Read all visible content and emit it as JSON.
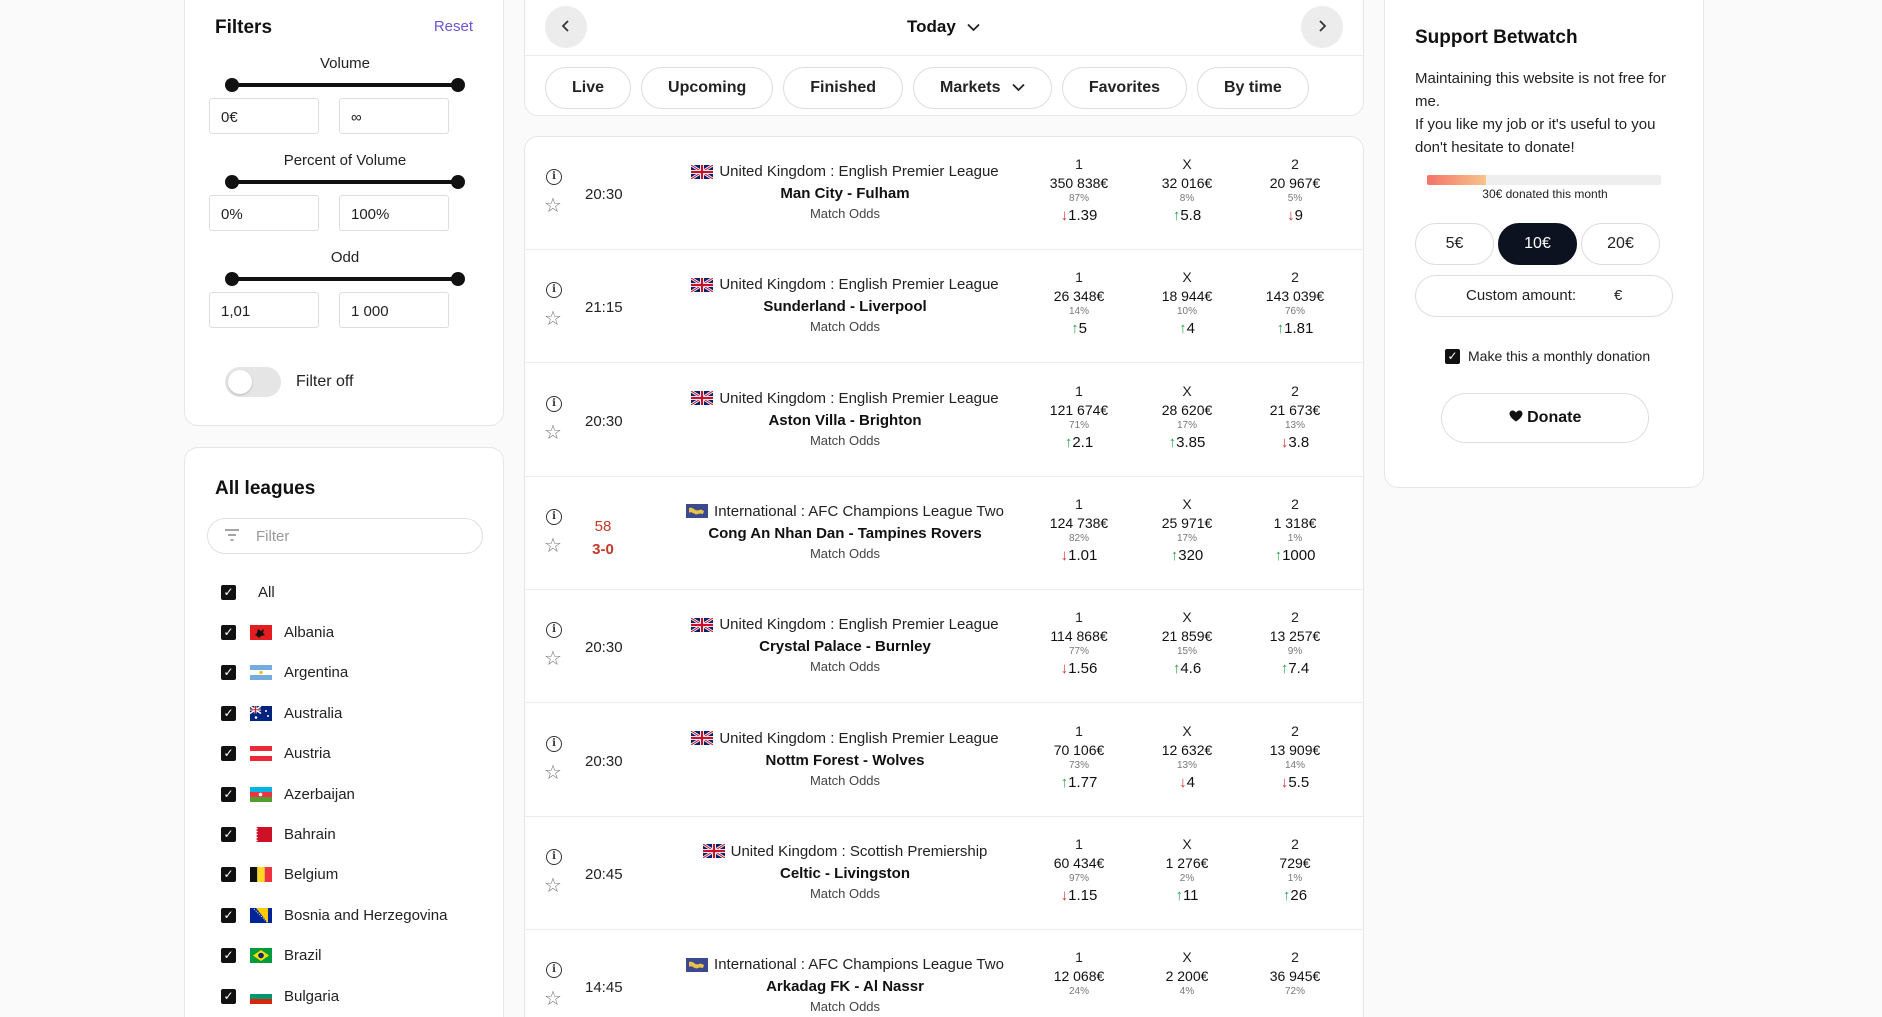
{
  "filters": {
    "title": "Filters",
    "reset": "Reset",
    "volume": {
      "label": "Volume",
      "min": "0€",
      "max": "∞"
    },
    "percent": {
      "label": "Percent of Volume",
      "min": "0%",
      "max": "100%"
    },
    "odd": {
      "label": "Odd",
      "min": "1,01",
      "max": "1 000"
    },
    "toggle_label": "Filter off"
  },
  "leagues": {
    "title": "All leagues",
    "search_placeholder": "Filter",
    "items": [
      {
        "label": "All",
        "checked": true
      },
      {
        "label": "Albania",
        "checked": true
      },
      {
        "label": "Argentina",
        "checked": true
      },
      {
        "label": "Australia",
        "checked": true
      },
      {
        "label": "Austria",
        "checked": true
      },
      {
        "label": "Azerbaijan",
        "checked": true
      },
      {
        "label": "Bahrain",
        "checked": true
      },
      {
        "label": "Belgium",
        "checked": true
      },
      {
        "label": "Bosnia and Herzegovina",
        "checked": true
      },
      {
        "label": "Brazil",
        "checked": true
      },
      {
        "label": "Bulgaria",
        "checked": true
      }
    ]
  },
  "header": {
    "date": "Today",
    "tabs": [
      "Live",
      "Upcoming",
      "Finished",
      "Markets",
      "Favorites",
      "By time"
    ]
  },
  "matches": [
    {
      "time": "20:30",
      "flag": "uk",
      "league": "United Kingdom : English Premier League",
      "teams": "Man City - Fulham",
      "market": "Match Odds",
      "odds": [
        {
          "k": "1",
          "v": "350 838€",
          "p": "87%",
          "dir": "down",
          "o": "1.39"
        },
        {
          "k": "X",
          "v": "32 016€",
          "p": "8%",
          "dir": "up",
          "o": "5.8"
        },
        {
          "k": "2",
          "v": "20 967€",
          "p": "5%",
          "dir": "down",
          "o": "9"
        }
      ]
    },
    {
      "time": "21:15",
      "flag": "uk",
      "league": "United Kingdom : English Premier League",
      "teams": "Sunderland - Liverpool",
      "market": "Match Odds",
      "odds": [
        {
          "k": "1",
          "v": "26 348€",
          "p": "14%",
          "dir": "up",
          "o": "5"
        },
        {
          "k": "X",
          "v": "18 944€",
          "p": "10%",
          "dir": "up",
          "o": "4"
        },
        {
          "k": "2",
          "v": "143 039€",
          "p": "76%",
          "dir": "up",
          "o": "1.81"
        }
      ]
    },
    {
      "time": "20:30",
      "flag": "uk",
      "league": "United Kingdom : English Premier League",
      "teams": "Aston Villa - Brighton",
      "market": "Match Odds",
      "odds": [
        {
          "k": "1",
          "v": "121 674€",
          "p": "71%",
          "dir": "up",
          "o": "2.1"
        },
        {
          "k": "X",
          "v": "28 620€",
          "p": "17%",
          "dir": "up",
          "o": "3.85"
        },
        {
          "k": "2",
          "v": "21 673€",
          "p": "13%",
          "dir": "down",
          "o": "3.8"
        }
      ]
    },
    {
      "time": "58",
      "score": "3-0",
      "live": true,
      "flag": "intl",
      "league": "International : AFC Champions League Two",
      "teams": "Cong An Nhan Dan - Tampines Rovers",
      "market": "Match Odds",
      "odds": [
        {
          "k": "1",
          "v": "124 738€",
          "p": "82%",
          "dir": "down",
          "o": "1.01"
        },
        {
          "k": "X",
          "v": "25 971€",
          "p": "17%",
          "dir": "up",
          "o": "320"
        },
        {
          "k": "2",
          "v": "1 318€",
          "p": "1%",
          "dir": "up",
          "o": "1000"
        }
      ]
    },
    {
      "time": "20:30",
      "flag": "uk",
      "league": "United Kingdom : English Premier League",
      "teams": "Crystal Palace - Burnley",
      "market": "Match Odds",
      "odds": [
        {
          "k": "1",
          "v": "114 868€",
          "p": "77%",
          "dir": "down",
          "o": "1.56"
        },
        {
          "k": "X",
          "v": "21 859€",
          "p": "15%",
          "dir": "up",
          "o": "4.6"
        },
        {
          "k": "2",
          "v": "13 257€",
          "p": "9%",
          "dir": "up",
          "o": "7.4"
        }
      ]
    },
    {
      "time": "20:30",
      "flag": "uk",
      "league": "United Kingdom : English Premier League",
      "teams": "Nottm Forest - Wolves",
      "market": "Match Odds",
      "odds": [
        {
          "k": "1",
          "v": "70 106€",
          "p": "73%",
          "dir": "up",
          "o": "1.77"
        },
        {
          "k": "X",
          "v": "12 632€",
          "p": "13%",
          "dir": "down",
          "o": "4"
        },
        {
          "k": "2",
          "v": "13 909€",
          "p": "14%",
          "dir": "down",
          "o": "5.5"
        }
      ]
    },
    {
      "time": "20:45",
      "flag": "uk",
      "league": "United Kingdom : Scottish Premiership",
      "teams": "Celtic - Livingston",
      "market": "Match Odds",
      "odds": [
        {
          "k": "1",
          "v": "60 434€",
          "p": "97%",
          "dir": "down",
          "o": "1.15"
        },
        {
          "k": "X",
          "v": "1 276€",
          "p": "2%",
          "dir": "up",
          "o": "11"
        },
        {
          "k": "2",
          "v": "729€",
          "p": "1%",
          "dir": "up",
          "o": "26"
        }
      ]
    },
    {
      "time": "14:45",
      "flag": "intl",
      "league": "International : AFC Champions League Two",
      "teams": "Arkadag FK - Al Nassr",
      "market": "Match Odds",
      "odds": [
        {
          "k": "1",
          "v": "12 068€",
          "p": "24%",
          "dir": "",
          "o": ""
        },
        {
          "k": "X",
          "v": "2 200€",
          "p": "4%",
          "dir": "",
          "o": ""
        },
        {
          "k": "2",
          "v": "36 945€",
          "p": "72%",
          "dir": "",
          "o": ""
        }
      ]
    }
  ],
  "support": {
    "title": "Support Betwatch",
    "text1": "Maintaining this website is not free for me.",
    "text2": "If you like my job or it's useful to you don't hesitate to donate!",
    "progress_fraction": 0.25,
    "progress_label": "30€ donated this month",
    "amounts": [
      "5€",
      "10€",
      "20€"
    ],
    "selected_amount": "10€",
    "custom_label": "Custom amount:",
    "currency": "€",
    "monthly_label": "Make this a monthly donation",
    "donate_label": "Donate"
  },
  "colors": {
    "accent": "#6a57d8",
    "up": "#2ea44f",
    "down": "#d63031",
    "selected": "#0d1220"
  }
}
